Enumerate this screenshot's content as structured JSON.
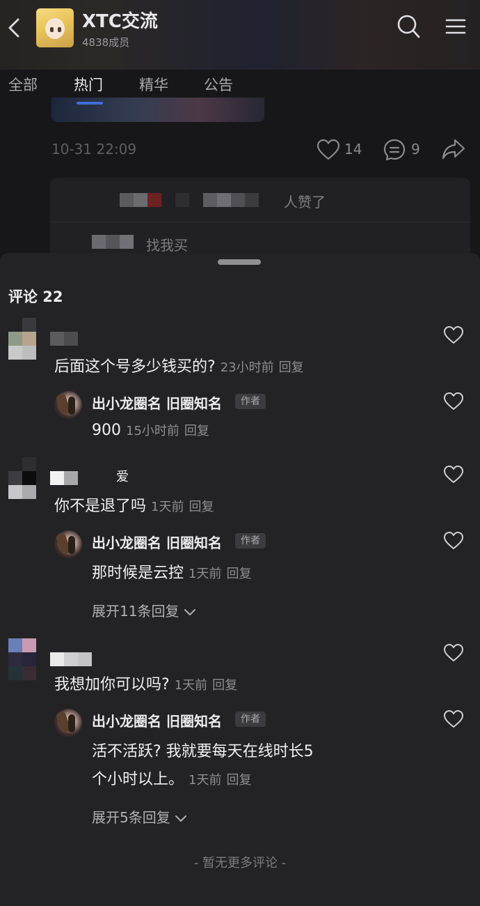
{
  "header": {
    "group_title": "XTC交流",
    "member_count": "4838成员"
  },
  "tabs": [
    {
      "label": "全部",
      "active": false
    },
    {
      "label": "热门",
      "active": true
    },
    {
      "label": "精华",
      "active": false
    },
    {
      "label": "公告",
      "active": false
    }
  ],
  "post": {
    "time": "10-31 22:09",
    "like_count": "14",
    "comment_count": "9",
    "liked_suffix": "人赞了",
    "reply_preview_text": "找我买"
  },
  "comments_section": {
    "title": "评论 22",
    "footer": "- 暂无更多评论 -"
  },
  "comments": [
    {
      "text": "后面这个号多少钱买的?",
      "time": "23小时前",
      "reply_label": "回复",
      "reply": {
        "author": "出小龙圈名 旧圈知名",
        "badge": "作者",
        "text": "900",
        "time": "15小时前",
        "reply_label": "回复"
      }
    },
    {
      "username_suffix": "爱",
      "text": "你不是退了吗",
      "time": "1天前",
      "reply_label": "回复",
      "reply": {
        "author": "出小龙圈名 旧圈知名",
        "badge": "作者",
        "text": "那时候是云控",
        "time": "1天前",
        "reply_label": "回复"
      },
      "expand_label": "展开11条回复"
    },
    {
      "text": "我想加你可以吗?",
      "time": "1天前",
      "reply_label": "回复",
      "reply": {
        "author": "出小龙圈名 旧圈知名",
        "badge": "作者",
        "text_line1": "活不活跃? 我就要每天在线时长5",
        "text_line2": "个小时以上。",
        "time": "1天前",
        "reply_label": "回复"
      },
      "expand_label": "展开5条回复"
    }
  ],
  "colors": {
    "accent": "#3f6fd8",
    "background": "#1b1b1d",
    "sheet": "#232326"
  },
  "icons": {
    "back": "back-arrow-icon",
    "search": "search-icon",
    "menu": "menu-icon",
    "like": "heart-icon",
    "comment": "comment-bubble-icon",
    "share": "share-arrow-icon",
    "expand": "chevron-down-icon"
  }
}
